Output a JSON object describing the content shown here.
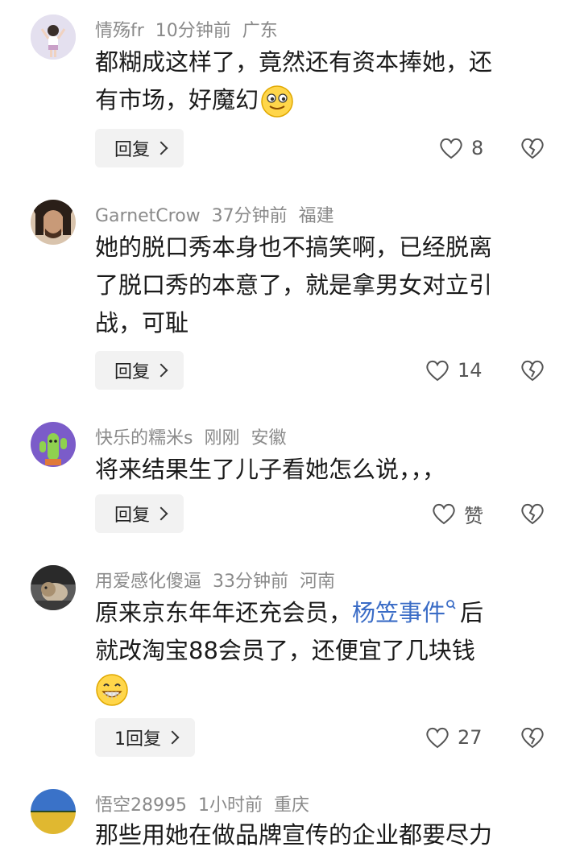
{
  "comments": [
    {
      "username": "情殇fr",
      "time": "10分钟前",
      "location": "广东",
      "text_lines": [
        "都糊成这样了，竟然还有资本捧她，还",
        "有市场，好魔幻"
      ],
      "emoji": "smile-emoji",
      "reply_label": "回复",
      "like_count": "8"
    },
    {
      "username": "GarnetCrow",
      "time": "37分钟前",
      "location": "福建",
      "text_lines": [
        "她的脱口秀本身也不搞笑啊，已经脱离",
        "了脱口秀的本意了，就是拿男女对立引",
        "战，可耻"
      ],
      "reply_label": "回复",
      "like_count": "14"
    },
    {
      "username": "快乐的糯米s",
      "time": "刚刚",
      "location": "安徽",
      "text_lines": [
        "将来结果生了儿子看她怎么说，，，"
      ],
      "reply_label": "回复",
      "like_count": "赞"
    },
    {
      "username": "用爱感化傻逼",
      "time": "33分钟前",
      "location": "河南",
      "text_line1_pre": "原来京东年年还充会员，",
      "link_text": "杨笠事件",
      "text_line1_post": "后",
      "text_line2": "就改淘宝88会员了，还便宜了几块钱",
      "emoji": "grin-emoji",
      "reply_label": "1回复",
      "like_count": "27"
    },
    {
      "username": "悟空28995",
      "time": "1小时前",
      "location": "重庆",
      "text_lines": [
        "那些用她在做品牌宣传的企业都要尽力"
      ]
    }
  ],
  "icons": {
    "like": "heart-outline-icon",
    "dislike": "broken-heart-icon",
    "search_link": "search-icon"
  },
  "colors": {
    "link": "#3a6cc6",
    "meta": "#8a8a8a",
    "button_bg": "#f2f2f2"
  }
}
